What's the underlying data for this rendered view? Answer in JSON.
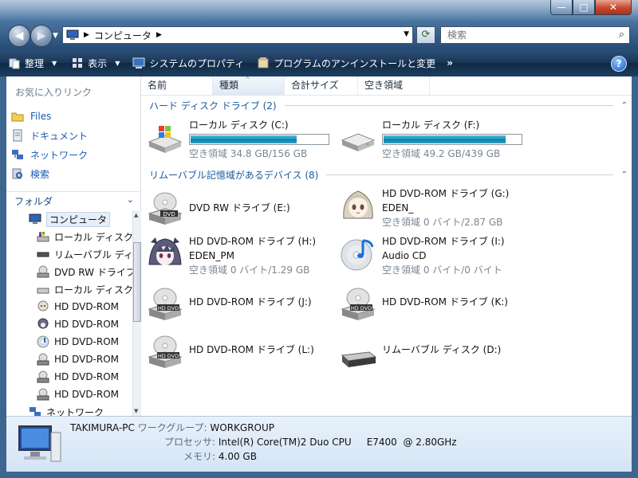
{
  "window": {
    "buttons": [
      "—",
      "□",
      "✕"
    ]
  },
  "address": {
    "crumbs": [
      "コンピュータ"
    ]
  },
  "search": {
    "placeholder": "検索"
  },
  "commands": [
    {
      "label": "整理",
      "icon": "organize-icon",
      "has_caret": true
    },
    {
      "label": "表示",
      "icon": "views-icon",
      "has_caret": true
    },
    {
      "label": "システムのプロパティ",
      "icon": "system-properties-icon",
      "has_caret": false
    },
    {
      "label": "プログラムのアンインストールと変更",
      "icon": "uninstall-icon",
      "has_caret": false
    }
  ],
  "command_more": "»",
  "favorites": {
    "title": "お気に入りリンク",
    "items": [
      {
        "label": "Files",
        "icon": "folder-icon"
      },
      {
        "label": "ドキュメント",
        "icon": "documents-icon"
      },
      {
        "label": "ネットワーク",
        "icon": "network-icon"
      },
      {
        "label": "検索",
        "icon": "search-folder-icon"
      }
    ]
  },
  "folders": {
    "title": "フォルダ",
    "tree": [
      {
        "label": "コンピュータ",
        "icon": "computer-icon",
        "indent": 1,
        "selected": true
      },
      {
        "label": "ローカル ディスク",
        "icon": "windows-drive-icon",
        "indent": 2
      },
      {
        "label": "リムーバブル ディスク",
        "icon": "removable-drive-icon",
        "indent": 2
      },
      {
        "label": "DVD RW ドライブ",
        "icon": "dvd-drive-icon",
        "indent": 2
      },
      {
        "label": "ローカル ディスク",
        "icon": "hard-drive-icon",
        "indent": 2
      },
      {
        "label": "HD DVD-ROM",
        "icon": "anime-girl-icon",
        "indent": 2
      },
      {
        "label": "HD DVD-ROM",
        "icon": "anime-girl-dark-icon",
        "indent": 2
      },
      {
        "label": "HD DVD-ROM",
        "icon": "audio-cd-icon",
        "indent": 2
      },
      {
        "label": "HD DVD-ROM",
        "icon": "hd-dvd-drive-icon",
        "indent": 2
      },
      {
        "label": "HD DVD-ROM",
        "icon": "hd-dvd-drive-icon",
        "indent": 2
      },
      {
        "label": "HD DVD-ROM",
        "icon": "hd-dvd-drive-icon",
        "indent": 2
      },
      {
        "label": "ネットワーク",
        "icon": "network-icon",
        "indent": 1
      }
    ]
  },
  "columns": [
    "名前",
    "種類",
    "合計サイズ",
    "空き領域"
  ],
  "groups": {
    "hdd": "ハード ディスク ドライブ (2)",
    "removable": "リムーバブル記憶域があるデバイス (8)"
  },
  "hdd_drives": [
    {
      "name": "ローカル ディスク (C:)",
      "free_text": "空き領域 34.8 GB/156 GB",
      "used_fraction": 0.777,
      "icon": "windows-drive-icon"
    },
    {
      "name": "ローカル ディスク (F:)",
      "free_text": "空き領域 49.2 GB/439 GB",
      "used_fraction": 0.888,
      "icon": "hard-drive-icon"
    }
  ],
  "removable_drives": [
    {
      "name": "DVD RW ドライブ (E:)",
      "sub": "",
      "free_text": "",
      "icon": "dvd-drive-icon"
    },
    {
      "name": "HD DVD-ROM ドライブ (G:)",
      "sub": "EDEN_",
      "free_text": "空き領域 0 バイト/2.87 GB",
      "icon": "anime-girl-icon"
    },
    {
      "name": "HD DVD-ROM ドライブ (H:)",
      "sub": "EDEN_PM",
      "free_text": "空き領域 0 バイト/1.29 GB",
      "icon": "anime-girl-dark-icon"
    },
    {
      "name": "HD DVD-ROM ドライブ (I:)",
      "sub": "Audio CD",
      "free_text": "空き領域 0 バイト/0 バイト",
      "icon": "audio-cd-icon"
    },
    {
      "name": "HD DVD-ROM ドライブ (J:)",
      "sub": "",
      "free_text": "",
      "icon": "hd-dvd-drive-icon"
    },
    {
      "name": "HD DVD-ROM ドライブ (K:)",
      "sub": "",
      "free_text": "",
      "icon": "hd-dvd-drive-icon"
    },
    {
      "name": "HD DVD-ROM ドライブ (L:)",
      "sub": "",
      "free_text": "",
      "icon": "hd-dvd-drive-icon"
    },
    {
      "name": "リムーバブル ディスク (D:)",
      "sub": "",
      "free_text": "",
      "icon": "removable-drive-icon"
    }
  ],
  "details": {
    "computer_name": "TAKIMURA-PC",
    "workgroup_label": "ワークグループ:",
    "workgroup": "WORKGROUP",
    "processor_label": "プロセッサ:",
    "processor": "Intel(R) Core(TM)2 Duo CPU     E7400  @ 2.80GHz",
    "memory_label": "メモリ:",
    "memory": "4.00 GB"
  },
  "colors": {
    "accent": "#1b5a9e",
    "bar_fill": "#1d8cb4",
    "link": "#1b59b5"
  }
}
